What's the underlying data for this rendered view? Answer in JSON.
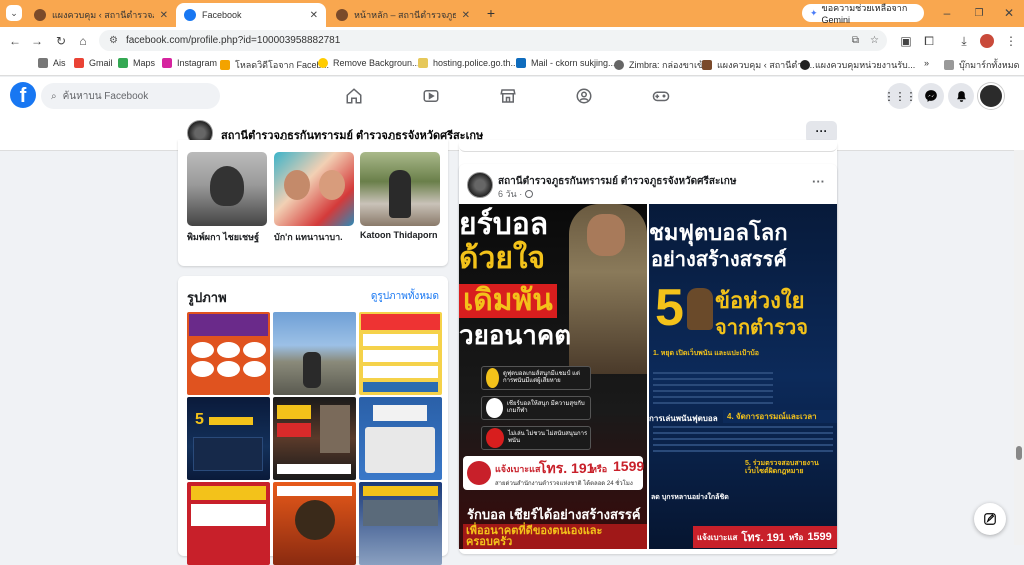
{
  "tabs": [
    {
      "title": "แผงควบคุม ‹ สถานีตำรวจภูธรกันทรารมย์"
    },
    {
      "title": "Facebook"
    },
    {
      "title": "หน้าหลัก – สถานีตำรวจภูธรกันทรารมย์"
    }
  ],
  "gemini_label": "ขอความช่วยเหลือจาก Gemini",
  "url": "facebook.com/profile.php?id=100003958882781",
  "bookmarks": [
    "Ais",
    "Gmail",
    "Maps",
    "Instagram",
    "โหลดวิดีโอจาก Faceb...",
    "Remove Backgroun...",
    "hosting.police.go.th...",
    "Mail - ckorn sukjing...",
    "Zimbra: กล่องขาเข้า",
    "แผงควบคุม ‹ สถานีตำร...",
    "แผงควบคุมหน่วยงานรับ..."
  ],
  "bookmarks_more": "»",
  "bookmarks_all": "บุ๊กมาร์กทั้งหมด",
  "fb": {
    "search_placeholder": "ค้นหาบน Facebook"
  },
  "page_name": "สถานีตำรวจภูธรกันทรารมย์ ตำรวจภูธรจังหวัดศรีสะเกษ",
  "more": "···",
  "friends": [
    {
      "name": "พิมพ์ผกา ไชยเชษฐ์"
    },
    {
      "name": "บัก'ก แทนานาบา."
    },
    {
      "name": "Katoon Thidaporn"
    }
  ],
  "photos": {
    "title": "รูปภาพ",
    "see_all": "ดูรูปภาพทั้งหมด"
  },
  "post": {
    "author": "สถานีตำรวจภูธรกันทรารมย์ ตำรวจภูธรจังหวัดศรีสะเกษ",
    "time": "6 วัน ·",
    "left": {
      "l1": "ยร์บอล",
      "l2": "ด้วยใจ",
      "l3": "เดิมพัน",
      "l4": "วยอนาคต",
      "b1": "ดูฟุตบอลเกมส์สนุกมีแชมป์ แต่การพนันมีแต่ผู้เสียหาย",
      "b2": "เชียร์บอลให้สนุก มีความสุขกับเกมกีฬา",
      "b3": "ไม่เล่น ไม่ชวน ไม่สนับสนุนการพนัน",
      "hot_prefix": "แจ้งเบาะแส",
      "hot_num": "โทร. 191",
      "hot_or": "หรือ",
      "hot_num2": "1599",
      "hot_sub": "สายด่วนสำนักงานตำรวจแห่งชาติ ได้ตลอด 24 ชั่วโมง",
      "foot1": "รักบอล เชียร์ได้อย่างสร้างสรรค์",
      "foot2": "เพื่ออนาคตที่ดีของตนเองและครอบครัว"
    },
    "right": {
      "l1": "ชมฟุตบอลโลก",
      "l2": "อย่างสร้างสรรค์",
      "num": "5",
      "l3": "ข้อห่วงใย",
      "l4": "จากตำรวจ",
      "i1": "1. หยุด เปิดเว็บพนัน และแปะเป้าบ้อ",
      "i2": "การเล่นพนันฟุตบอล",
      "i3": "4. จัดการอารมณ์และเวลา",
      "i4": "5. ร่วมตรวจสอบสายงาน เว็บไซต์ผิดกฎหมาย",
      "i5": "ลด บุกรหลานอย่างใกล้ชิด",
      "hot_prefix": "แจ้งเบาะแส",
      "hot_num": "โทร. 191",
      "hot_or": "หรือ",
      "hot_num2": "1599"
    }
  }
}
